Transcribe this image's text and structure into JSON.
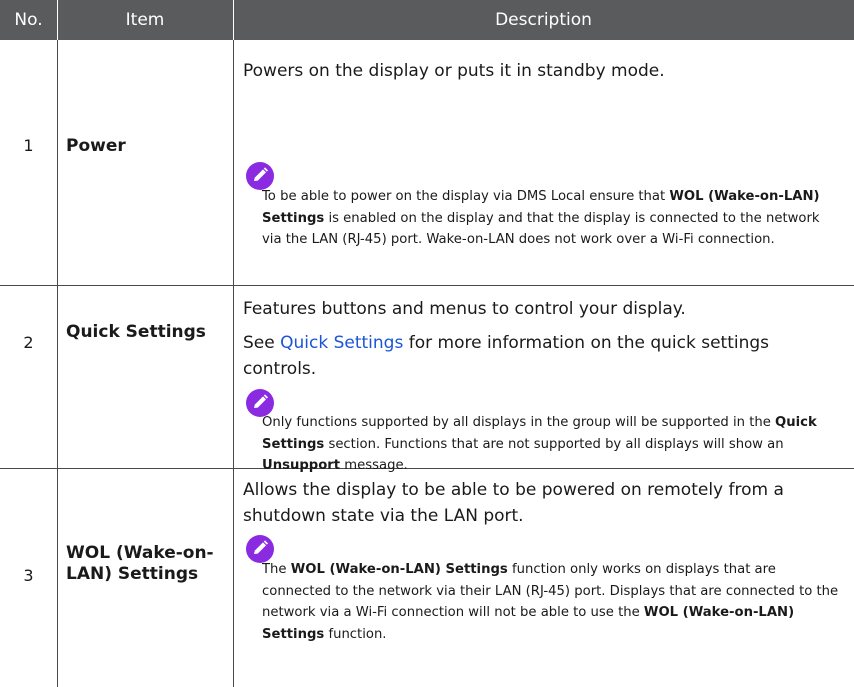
{
  "header": {
    "col_no": "No.",
    "col_item": "Item",
    "col_desc": "Description"
  },
  "rows": [
    {
      "num": "1",
      "item": "Power",
      "desc": "Powers on the display or puts it in standby mode.",
      "note": {
        "p1": "To be able to power on the display via DMS Local ensure that ",
        "b1": "WOL (Wake-on-LAN) Settings",
        "p2": " is enabled on the display and that the display is connected to the network via the LAN (RJ-45) port. Wake-on-LAN does not work over a Wi-Fi connection."
      }
    },
    {
      "num": "2",
      "item": "Quick Settings",
      "desc": "Features buttons and menus to control your display.",
      "desc2_pre": "See ",
      "desc2_link": "Quick Settings",
      "desc2_post": " for more information on the quick settings controls.",
      "note": {
        "p1": "Only functions supported by all displays in the group will be supported in the ",
        "b1": "Quick Settings",
        "p2": " section. Functions that are not supported by all displays will show an ",
        "b2": "Unsupport",
        "p3": " message."
      }
    },
    {
      "num": "3",
      "item": "WOL (Wake-on-LAN) Settings",
      "desc": "Allows the display to be able to be powered on remotely from a shutdown state via the LAN port.",
      "note": {
        "p1": "The ",
        "b1": "WOL (Wake-on-LAN) Settings",
        "p2": " function only works on displays that are connected to the network via their LAN (RJ-45) port. Displays that are connected to the network via a Wi-Fi connection will not be able to use the ",
        "b2": "WOL (Wake-on-LAN) Settings",
        "p3": " function."
      }
    }
  ],
  "colors": {
    "header_bg": "#5a5b5d",
    "note_icon": "#8a2be2",
    "link": "#1a55d6"
  },
  "icons": {
    "note": "pencil-note-icon"
  }
}
